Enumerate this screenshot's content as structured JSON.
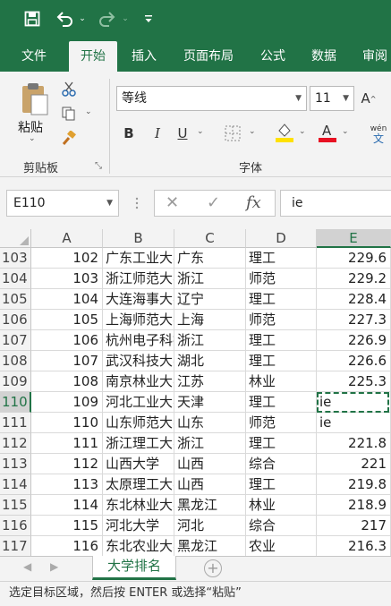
{
  "quick_access": {
    "icons": [
      "save-icon",
      "undo-icon",
      "redo-icon",
      "customize-icon"
    ]
  },
  "tabs": [
    "文件",
    "开始",
    "插入",
    "页面布局",
    "公式",
    "数据",
    "审阅"
  ],
  "active_tab": "开始",
  "ribbon": {
    "clipboard": {
      "paste_label": "粘贴",
      "group_label": "剪贴板"
    },
    "font": {
      "font_name": "等线",
      "font_size": "11",
      "group_label": "字体",
      "bold": "B",
      "italic": "I",
      "underline": "U",
      "grow_font": "A",
      "phonetic_top": "wén",
      "phonetic_bottom": "文",
      "font_color_hex": "#e81123",
      "fill_color_hex": "#ffe100"
    }
  },
  "formula_bar": {
    "name_box": "E110",
    "cancel": "✕",
    "enter": "✓",
    "fx": "fx",
    "value": "ie"
  },
  "grid": {
    "columns": [
      "A",
      "B",
      "C",
      "D",
      "E"
    ],
    "selected_column": "E",
    "selected_row": "110",
    "rows": [
      {
        "row": "103",
        "a": "102",
        "b": "广东工业大学",
        "c": "广东",
        "d": "理工",
        "e": "229.6"
      },
      {
        "row": "104",
        "a": "103",
        "b": "浙江师范大学",
        "c": "浙江",
        "d": "师范",
        "e": "229.2"
      },
      {
        "row": "105",
        "a": "104",
        "b": "大连海事大学",
        "c": "辽宁",
        "d": "理工",
        "e": "228.4"
      },
      {
        "row": "106",
        "a": "105",
        "b": "上海师范大学",
        "c": "上海",
        "d": "师范",
        "e": "227.3"
      },
      {
        "row": "107",
        "a": "106",
        "b": "杭州电子科技大学",
        "c": "浙江",
        "d": "理工",
        "e": "226.9"
      },
      {
        "row": "108",
        "a": "107",
        "b": "武汉科技大学",
        "c": "湖北",
        "d": "理工",
        "e": "226.6"
      },
      {
        "row": "109",
        "a": "108",
        "b": "南京林业大学",
        "c": "江苏",
        "d": "林业",
        "e": "225.3"
      },
      {
        "row": "110",
        "a": "109",
        "b": "河北工业大学",
        "c": "天津",
        "d": "理工",
        "e": "ie"
      },
      {
        "row": "111",
        "a": "110",
        "b": "山东师范大学",
        "c": "山东",
        "d": "师范",
        "e": "ie"
      },
      {
        "row": "112",
        "a": "111",
        "b": "浙江理工大学",
        "c": "浙江",
        "d": "理工",
        "e": "221.8"
      },
      {
        "row": "113",
        "a": "112",
        "b": "山西大学",
        "c": "山西",
        "d": "综合",
        "e": "221"
      },
      {
        "row": "114",
        "a": "113",
        "b": "太原理工大学",
        "c": "山西",
        "d": "理工",
        "e": "219.8"
      },
      {
        "row": "115",
        "a": "114",
        "b": "东北林业大学",
        "c": "黑龙江",
        "d": "林业",
        "e": "218.9"
      },
      {
        "row": "116",
        "a": "115",
        "b": "河北大学",
        "c": "河北",
        "d": "综合",
        "e": "217"
      },
      {
        "row": "117",
        "a": "116",
        "b": "东北农业大学",
        "c": "黑龙江",
        "d": "农业",
        "e": "216.3"
      }
    ]
  },
  "sheet_tabs": {
    "active": "大学排名",
    "add_icon": "plus-circle-icon"
  },
  "status_bar": {
    "message": "选定目标区域，然后按 ENTER 或选择“粘贴”"
  },
  "colors": {
    "accent": "#217346",
    "ribbon_bg": "#f3f3f3"
  }
}
